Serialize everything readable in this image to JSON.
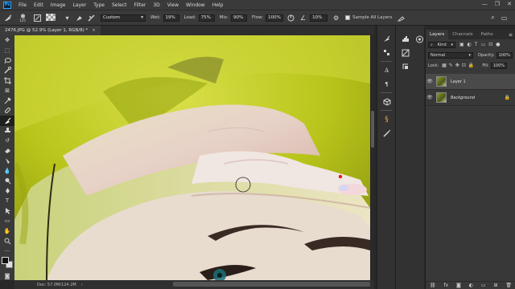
{
  "menubar": {
    "app_icon": "Ps",
    "items": [
      "File",
      "Edit",
      "Image",
      "Layer",
      "Type",
      "Select",
      "Filter",
      "3D",
      "View",
      "Window",
      "Help"
    ],
    "window_controls": [
      "—",
      "❐",
      "✕"
    ]
  },
  "options": {
    "brush_size": "125",
    "preset": "Custom",
    "wet_label": "Wet:",
    "wet_value": "19%",
    "load_label": "Load:",
    "load_value": "75%",
    "mix_label": "Mix:",
    "mix_value": "90%",
    "flow_label": "Flow:",
    "flow_value": "100%",
    "angle_value": "10%",
    "sample_all_label": "Sample All Layers"
  },
  "document": {
    "tab_title": "2476.JPG @ 52.9% (Layer 1, RGB/8) *",
    "status_text": "Doc: 57.0M/124.2M"
  },
  "layers_panel": {
    "tabs": [
      "Layers",
      "Channels",
      "Paths"
    ],
    "filter_kind": "Kind",
    "blend_mode": "Normal",
    "opacity_label": "Opacity:",
    "opacity_value": "100%",
    "lock_label": "Lock:",
    "fill_label": "Fill:",
    "fill_value": "100%",
    "layers": [
      {
        "name": "Layer 1",
        "selected": true
      },
      {
        "name": "Background",
        "selected": false
      }
    ]
  },
  "colors": {
    "accent": "#31a8ff",
    "chrome_dark": "#282828",
    "panel": "#383838",
    "backdrop_yellow": "#b8c41a"
  }
}
